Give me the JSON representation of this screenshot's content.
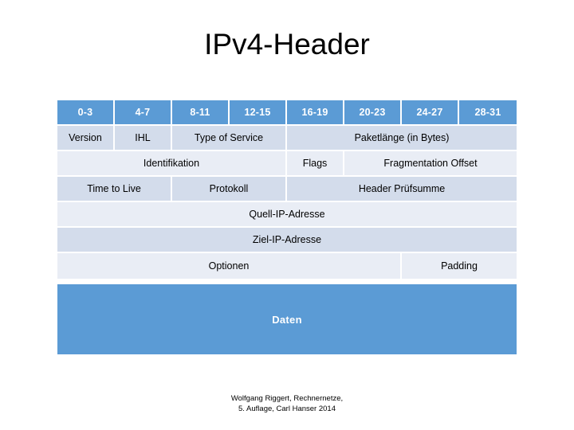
{
  "slide": {
    "title": "IPv4-Header",
    "background_color": "#FFFFFF"
  },
  "colors": {
    "header_blue": "#5B9BD5",
    "band_dark": "#D3DCEB",
    "band_light": "#E9EDF5",
    "grid_line": "#FFFFFF",
    "text": "#000000",
    "header_text": "#FFFFFF"
  },
  "table": {
    "bit_columns": [
      {
        "label": "0-3"
      },
      {
        "label": "4-7"
      },
      {
        "label": "8-11"
      },
      {
        "label": "12-15"
      },
      {
        "label": "16-19"
      },
      {
        "label": "20-23"
      },
      {
        "label": "24-27"
      },
      {
        "label": "28-31"
      }
    ],
    "rows": [
      {
        "tone": "dark",
        "cells": [
          {
            "label": "Version",
            "span": 1
          },
          {
            "label": "IHL",
            "span": 1
          },
          {
            "label": "Type of Service",
            "span": 2
          },
          {
            "label": "Paketlänge (in Bytes)",
            "span": 4
          }
        ]
      },
      {
        "tone": "light",
        "cells": [
          {
            "label": "Identifikation",
            "span": 4
          },
          {
            "label": "Flags",
            "span": 1
          },
          {
            "label": "Fragmentation Offset",
            "span": 3
          }
        ]
      },
      {
        "tone": "dark",
        "cells": [
          {
            "label": "Time to Live",
            "span": 2
          },
          {
            "label": "Protokoll",
            "span": 2
          },
          {
            "label": "Header Prüfsumme",
            "span": 4
          }
        ]
      },
      {
        "tone": "light",
        "cells": [
          {
            "label": "Quell-IP-Adresse",
            "span": 8
          }
        ]
      },
      {
        "tone": "dark",
        "cells": [
          {
            "label": "Ziel-IP-Adresse",
            "span": 8
          }
        ]
      },
      {
        "tone": "light",
        "cells": [
          {
            "label": "Optionen",
            "span": 6
          },
          {
            "label": "Padding",
            "span": 2
          }
        ]
      }
    ]
  },
  "data_block": {
    "label": "Daten",
    "color": "#5B9BD5"
  },
  "footer": {
    "line1": "Wolfgang Riggert, Rechnernetze,",
    "line2": "5. Auflage, Carl Hanser 2014"
  }
}
